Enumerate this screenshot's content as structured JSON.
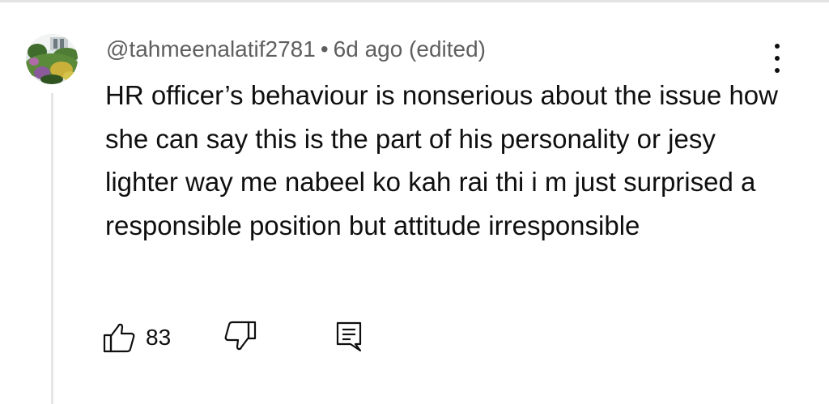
{
  "comment": {
    "author": "@tahmeenalatif2781",
    "separator": "•",
    "time": "6d ago (edited)",
    "text": "HR officer’s behaviour is nonserious about the issue how she can say this is the part of his personality or jesy lighter way me nabeel ko kah rai thi i m just surprised a responsible position but attitude irresponsible",
    "like_count": "83"
  },
  "icons": {
    "avatar": "avatar-garden-photo",
    "menu": "more-vert-icon",
    "like": "thumbs-up-icon",
    "dislike": "thumbs-down-icon",
    "reply": "comment-reply-icon"
  },
  "colors": {
    "text": "#0f0f0f",
    "meta": "#5f5f5f",
    "thread_line": "#e6e6e6"
  }
}
